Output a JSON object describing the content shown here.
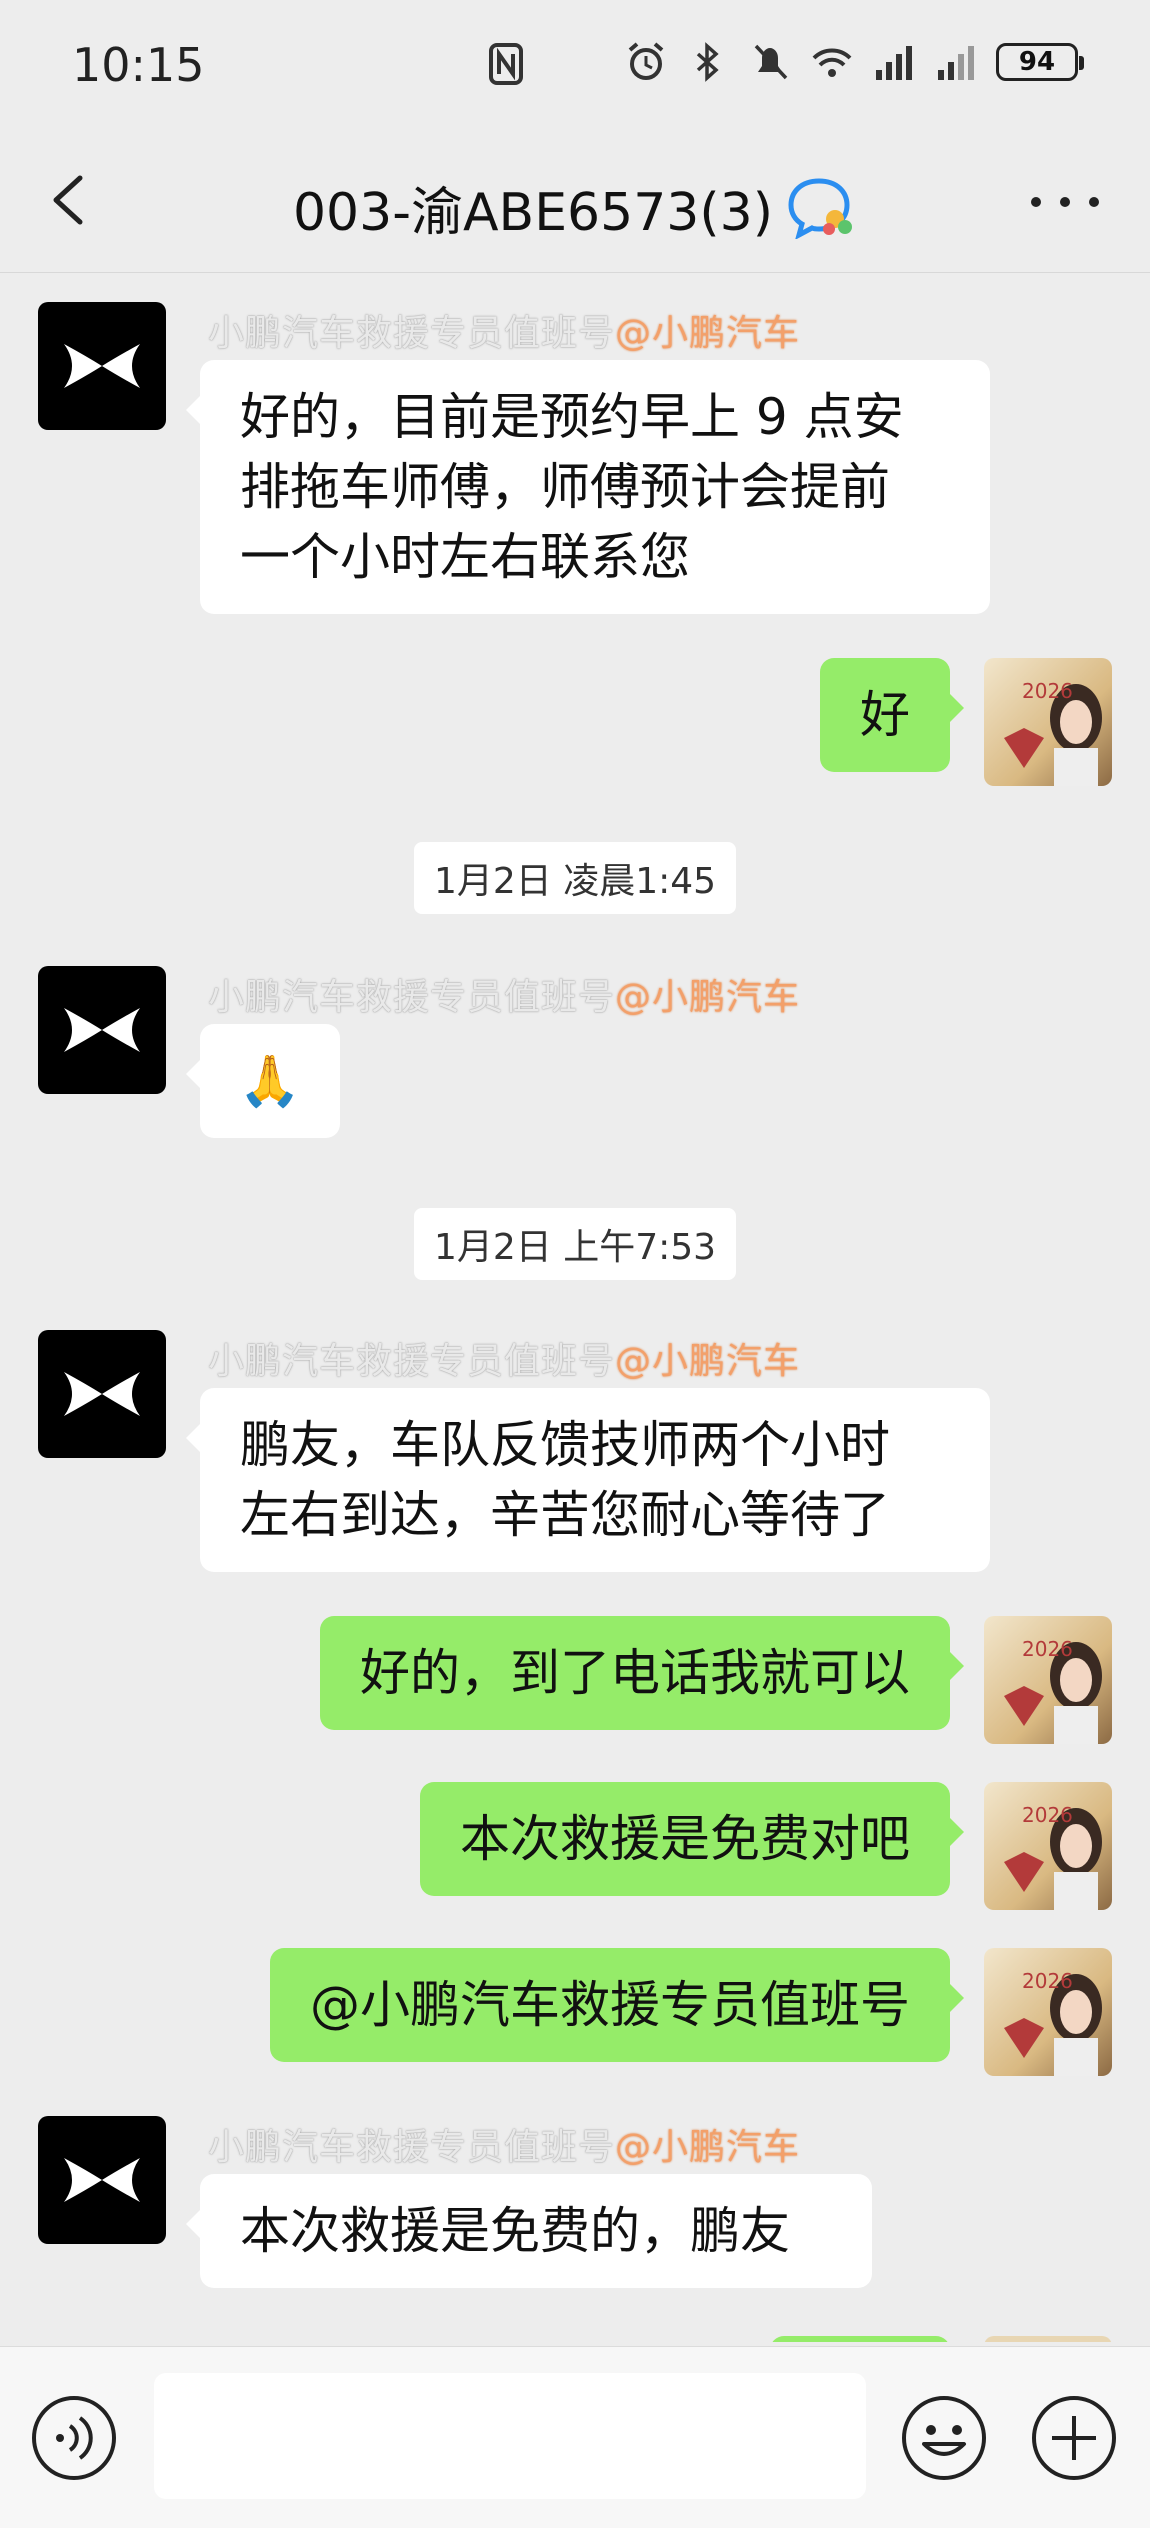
{
  "status_bar": {
    "time": "10:15",
    "battery": "94"
  },
  "header": {
    "title": "003-渝ABE6573(3)"
  },
  "messages": [
    {
      "side": "left",
      "sender_name": "小鹏汽车救援专员值班号",
      "sender_org": "@小鹏汽车",
      "lines": [
        "好的，目前是预约早上 9 点安",
        "排拖车师傅，师傅预计会提前",
        "一个小时左右联系您"
      ]
    },
    {
      "side": "right",
      "text": "好"
    },
    {
      "type": "time",
      "text": "1月2日 凌晨1:45"
    },
    {
      "side": "left",
      "sender_name": "小鹏汽车救援专员值班号",
      "sender_org": "@小鹏汽车",
      "emoji": "🙏"
    },
    {
      "type": "time",
      "text": "1月2日 上午7:53"
    },
    {
      "side": "left",
      "sender_name": "小鹏汽车救援专员值班号",
      "sender_org": "@小鹏汽车",
      "lines": [
        "鹏友，车队反馈技师两个小时",
        "左右到达，辛苦您耐心等待了"
      ]
    },
    {
      "side": "right",
      "text": "好的，到了电话我就可以"
    },
    {
      "side": "right",
      "text": "本次救援是免费对吧"
    },
    {
      "side": "right",
      "text": "@小鹏汽车救援专员值班号"
    },
    {
      "side": "left",
      "sender_name": "小鹏汽车救援专员值班号",
      "sender_org": "@小鹏汽车",
      "lines": [
        "本次救援是免费的，鹏友"
      ]
    }
  ],
  "avatar_me": {
    "badge": "2026"
  },
  "input": {
    "value": ""
  },
  "icons": {
    "back": "chevron-left-icon",
    "group": "group-chat-icon",
    "more": "more-icon",
    "voice": "voice-icon",
    "emoji": "emoji-icon",
    "plus": "plus-icon"
  },
  "colors": {
    "sent_bubble": "#95ec69",
    "received_bubble": "#ffffff",
    "background": "#ededed"
  }
}
